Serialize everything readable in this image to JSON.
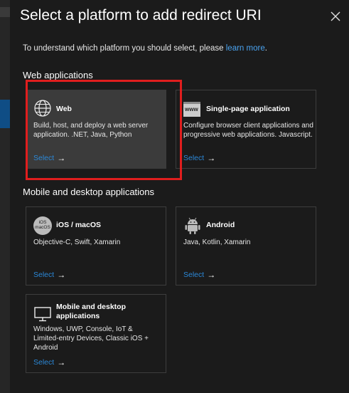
{
  "title": "Select a platform to add redirect URI",
  "intro": {
    "text": "To understand which platform you should select, please ",
    "link": "learn more",
    "suffix": "."
  },
  "sections": {
    "web": "Web applications",
    "mobile": "Mobile and desktop applications"
  },
  "select_label": "Select",
  "cards": {
    "web": {
      "name": "Web",
      "desc": "Build, host, and deploy a web server application. .NET, Java, Python",
      "icon": "globe-icon"
    },
    "spa": {
      "name": "Single-page application",
      "desc": "Configure browser client applications and progressive web applications. Javascript.",
      "icon": "www-icon",
      "icon_text": "www"
    },
    "ios": {
      "name": "iOS / macOS",
      "desc": "Objective-C, Swift, Xamarin",
      "icon": "ios-macos-icon",
      "icon_text": [
        "iOS",
        "macOS"
      ]
    },
    "android": {
      "name": "Android",
      "desc": "Java, Kotlin, Xamarin",
      "icon": "android-icon"
    },
    "desktop": {
      "name": "Mobile and desktop applications",
      "desc": "Windows, UWP, Console, IoT & Limited-entry Devices, Classic iOS + Android",
      "icon": "monitor-icon"
    }
  },
  "colors": {
    "accent": "#2b88d8",
    "link": "#4aa3f0",
    "highlight": "#e01e1e",
    "selected_card": "#3b3b3b"
  }
}
